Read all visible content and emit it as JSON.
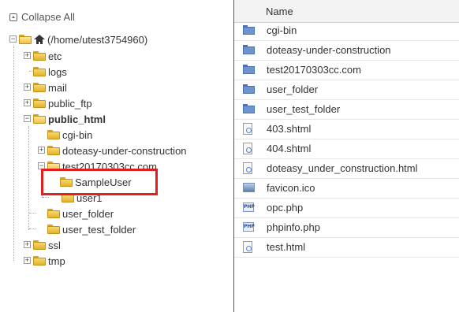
{
  "tree": {
    "collapse_all": "Collapse All",
    "root": "(/home/utest3754960)",
    "nodes": {
      "etc": "etc",
      "logs": "logs",
      "mail": "mail",
      "public_ftp": "public_ftp",
      "public_html": "public_html",
      "cgi_bin": "cgi-bin",
      "doteasy": "doteasy-under-construction",
      "test2017": "test20170303cc.com",
      "sampleuser": "SampleUser",
      "user1": "user1",
      "user_folder": "user_folder",
      "user_test_folder": "user_test_folder",
      "ssl": "ssl",
      "tmp": "tmp"
    }
  },
  "files": {
    "header_name": "Name",
    "rows": [
      {
        "name": "cgi-bin",
        "icon": "folder-icon"
      },
      {
        "name": "doteasy-under-construction",
        "icon": "folder-icon"
      },
      {
        "name": "test20170303cc.com",
        "icon": "folder-icon"
      },
      {
        "name": "user_folder",
        "icon": "folder-icon"
      },
      {
        "name": "user_test_folder",
        "icon": "folder-icon"
      },
      {
        "name": "403.shtml",
        "icon": "html-file-icon"
      },
      {
        "name": "404.shtml",
        "icon": "html-file-icon"
      },
      {
        "name": "doteasy_under_construction.html",
        "icon": "html-file-icon"
      },
      {
        "name": "favicon.ico",
        "icon": "image-file-icon"
      },
      {
        "name": "opc.php",
        "icon": "php-file-icon"
      },
      {
        "name": "phpinfo.php",
        "icon": "php-file-icon"
      },
      {
        "name": "test.html",
        "icon": "html-file-icon"
      }
    ]
  },
  "icon_labels": {
    "php": "PHP"
  },
  "colors": {
    "highlight": "#e02020",
    "folder_blue": "#6f93cf",
    "folder_yellow": "#f6d86b"
  }
}
